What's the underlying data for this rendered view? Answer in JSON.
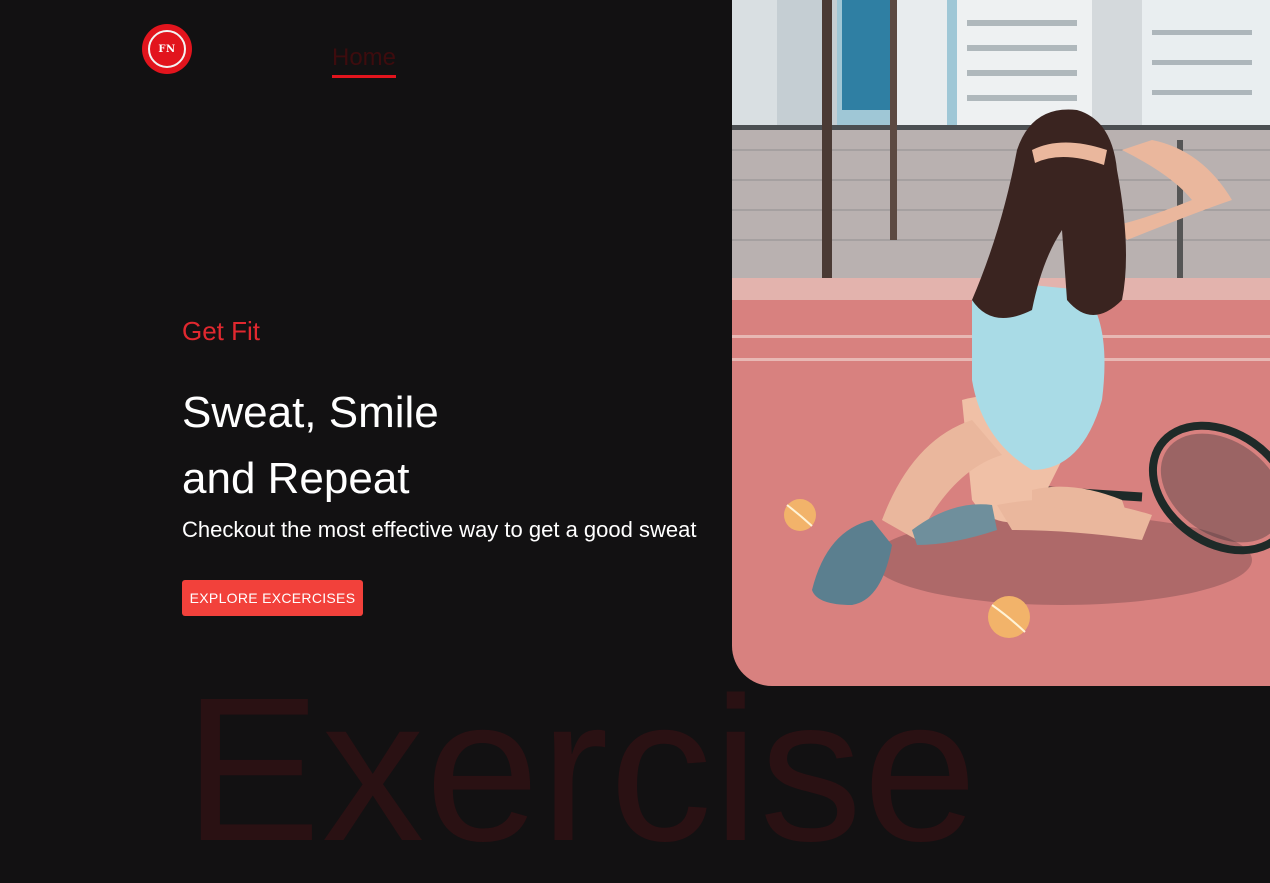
{
  "navbar": {
    "logo_text": "FN",
    "home_label": "Home"
  },
  "hero": {
    "eyebrow": "Get Fit",
    "headline_line1": "Sweat, Smile",
    "headline_line2": "and Repeat",
    "subtitle": "Checkout the most effective way to get a good sweat",
    "cta_label": "EXPLORE EXCERCISES"
  },
  "watermark": "Exercise",
  "colors": {
    "background": "#121112",
    "accent": "#e2141d",
    "button": "#f2413b",
    "watermark": "#2a1113",
    "text": "#ffffff"
  }
}
